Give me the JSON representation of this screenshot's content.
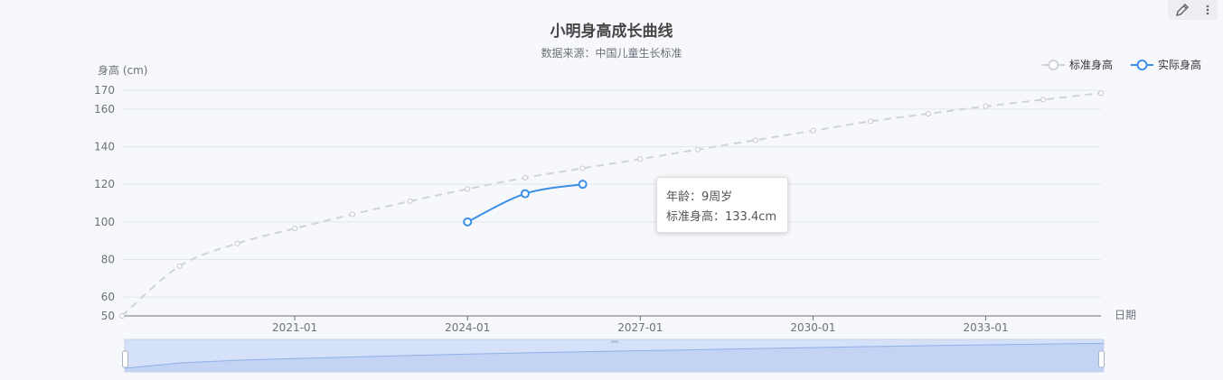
{
  "title": "小明身高成长曲线",
  "subtitle": "数据来源：中国儿童生长标准",
  "toolbar": {
    "edit_icon": "pencil-icon",
    "more_icon": "more-vertical-icon"
  },
  "legend": [
    {
      "label": "标准身高",
      "color": "#d0d3da"
    },
    {
      "label": "实际身高",
      "color": "#3b8fe8"
    }
  ],
  "tooltip": {
    "age_line": "年龄：9周岁",
    "height_line": "标准身高：133.4cm"
  },
  "chart_data": {
    "type": "line",
    "title": "小明身高成长曲线",
    "subtitle": "数据来源：中国儿童生长标准",
    "xlabel": "日期",
    "ylabel": "身高 (cm)",
    "ylim": [
      50,
      170
    ],
    "y_ticks": [
      50,
      60,
      80,
      100,
      120,
      140,
      160,
      170
    ],
    "x_ticks": [
      "2021-01",
      "2024-01",
      "2027-01",
      "2030-01",
      "2033-01"
    ],
    "x_range": [
      "2018-01",
      "2035-01"
    ],
    "grid": true,
    "legend_position": "top-right",
    "series": [
      {
        "name": "标准身高",
        "color": "#d0d3da",
        "style": "dashed",
        "points": [
          [
            "2018-01",
            50.0
          ],
          [
            "2019-01",
            76.5
          ],
          [
            "2020-01",
            88.5
          ],
          [
            "2021-01",
            96.5
          ],
          [
            "2022-01",
            104.0
          ],
          [
            "2023-01",
            111.0
          ],
          [
            "2024-01",
            117.5
          ],
          [
            "2025-01",
            123.5
          ],
          [
            "2026-01",
            128.5
          ],
          [
            "2027-01",
            133.4
          ],
          [
            "2028-01",
            138.5
          ],
          [
            "2029-01",
            143.5
          ],
          [
            "2030-01",
            148.5
          ],
          [
            "2031-01",
            153.5
          ],
          [
            "2032-01",
            157.5
          ],
          [
            "2033-01",
            161.5
          ],
          [
            "2034-01",
            165.0
          ],
          [
            "2035-01",
            168.5
          ]
        ]
      },
      {
        "name": "实际身高",
        "color": "#3b8fe8",
        "style": "solid",
        "points": [
          [
            "2024-01",
            100.0
          ],
          [
            "2025-01",
            115.0
          ],
          [
            "2026-01",
            120.0
          ]
        ]
      }
    ]
  }
}
